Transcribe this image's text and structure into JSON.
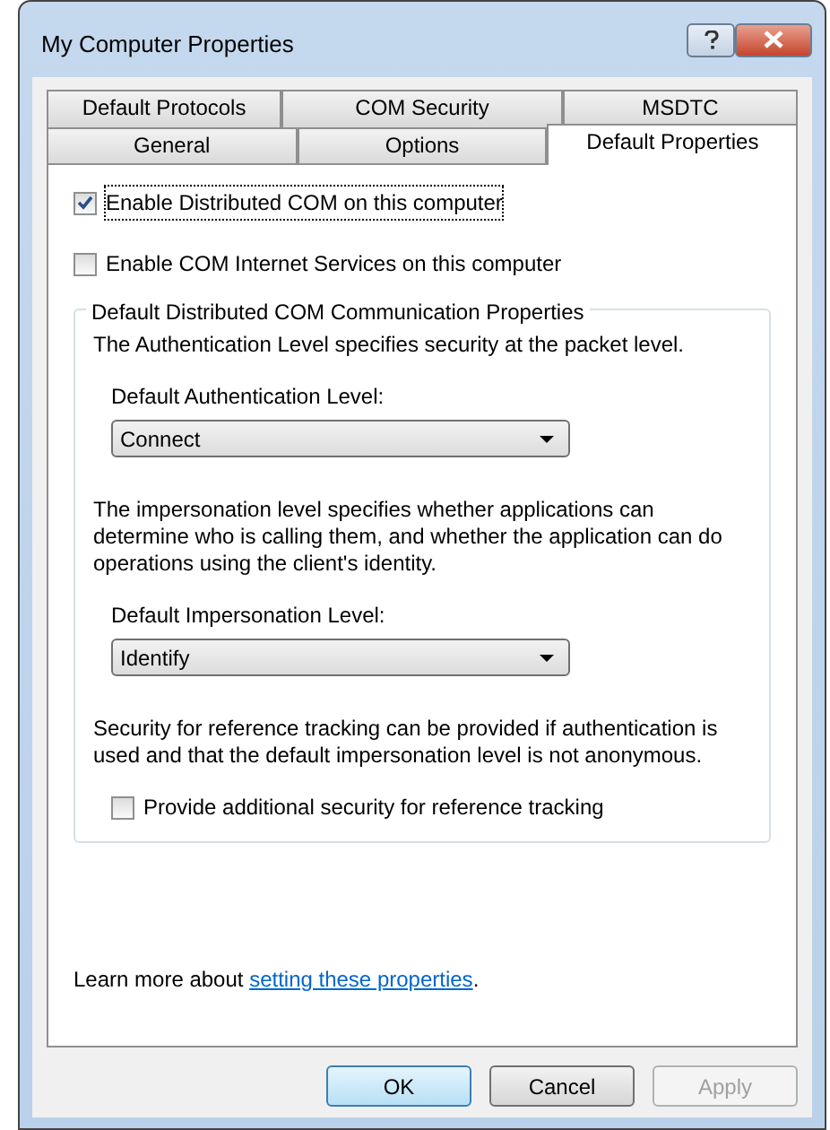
{
  "window": {
    "title": "My Computer Properties"
  },
  "tab_rows": [
    {
      "tabs": [
        {
          "label": "Default Protocols",
          "selected": false
        },
        {
          "label": "COM Security",
          "selected": false
        },
        {
          "label": "MSDTC",
          "selected": false
        }
      ]
    },
    {
      "tabs": [
        {
          "label": "General",
          "selected": false
        },
        {
          "label": "Options",
          "selected": false
        },
        {
          "label": "Default Properties",
          "selected": true
        }
      ]
    }
  ],
  "options": [
    {
      "label": "Enable Distributed COM on this computer",
      "checked": true,
      "focused": true
    },
    {
      "label": "Enable COM Internet Services on this computer",
      "checked": false,
      "focused": false
    }
  ],
  "group": {
    "title": "Default Distributed COM Communication Properties",
    "items": [
      {
        "kind": "text",
        "text": "The Authentication Level specifies security at the packet level."
      },
      {
        "kind": "dropdown",
        "label": "Default Authentication Level:",
        "value": "Connect"
      },
      {
        "kind": "text",
        "text": "The impersonation level specifies whether applications can determine who is calling them, and whether the application can do operations using the client's identity."
      },
      {
        "kind": "dropdown",
        "label": "Default Impersonation Level:",
        "value": "Identify"
      },
      {
        "kind": "text",
        "text": "Security for reference tracking can be provided if authentication is used and that the default impersonation level is not anonymous."
      },
      {
        "kind": "checkbox",
        "label": "Provide additional security for reference tracking",
        "checked": false
      }
    ]
  },
  "learn_more": {
    "text": "Learn more about",
    "link": "setting these properties",
    "after": "."
  },
  "buttons": [
    {
      "label": "OK",
      "default": true,
      "disabled": false
    },
    {
      "label": "Cancel",
      "default": false,
      "disabled": false
    },
    {
      "label": "Apply",
      "default": false,
      "disabled": true
    }
  ]
}
